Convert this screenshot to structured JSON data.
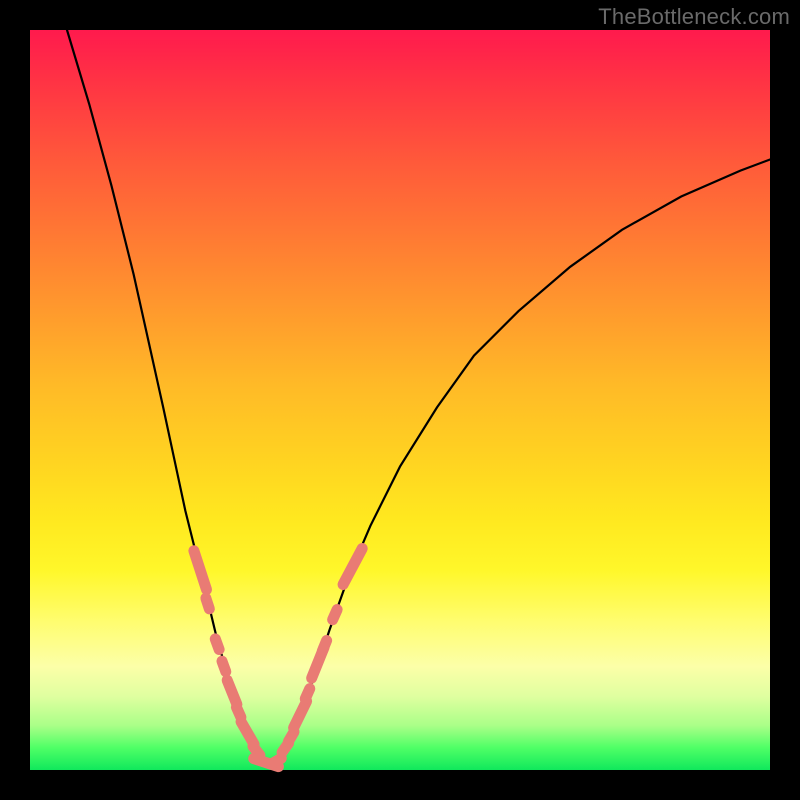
{
  "watermark": "TheBottleneck.com",
  "chart_data": {
    "type": "line",
    "title": "",
    "xlabel": "",
    "ylabel": "",
    "xlim": [
      0,
      100
    ],
    "ylim": [
      0,
      100
    ],
    "grid": false,
    "legend": false,
    "background": "vertical-gradient red→orange→yellow→green",
    "series": [
      {
        "name": "left-branch",
        "x": [
          5,
          8,
          11,
          14,
          16,
          18,
          19.5,
          21,
          22.5,
          24,
          25.2,
          26.5,
          27.7,
          29,
          30,
          31,
          31.8
        ],
        "y": [
          100,
          90,
          79,
          67,
          58,
          49,
          42,
          35,
          29,
          23,
          18,
          13.5,
          9.5,
          6,
          3.5,
          1.6,
          0.5
        ]
      },
      {
        "name": "right-branch",
        "x": [
          33,
          34,
          35.3,
          36.8,
          38.5,
          40.5,
          43,
          46,
          50,
          55,
          60,
          66,
          73,
          80,
          88,
          96,
          100
        ],
        "y": [
          0.5,
          1.8,
          4.2,
          8,
          13,
          19,
          26,
          33,
          41,
          49,
          56,
          62,
          68,
          73,
          77.5,
          81,
          82.5
        ]
      }
    ],
    "markers": {
      "description": "salmon pill-shaped markers on both branches roughly between y=5 and y=32",
      "points": [
        {
          "x": 23.0,
          "y": 27.0,
          "len": 7.0,
          "angle": -72
        },
        {
          "x": 24.0,
          "y": 22.5,
          "len": 3.0,
          "angle": -72
        },
        {
          "x": 25.3,
          "y": 17.0,
          "len": 3.0,
          "angle": -70
        },
        {
          "x": 26.2,
          "y": 14.0,
          "len": 3.0,
          "angle": -70
        },
        {
          "x": 27.3,
          "y": 10.5,
          "len": 5.0,
          "angle": -68
        },
        {
          "x": 28.2,
          "y": 7.8,
          "len": 3.0,
          "angle": -66
        },
        {
          "x": 29.4,
          "y": 5.0,
          "len": 5.0,
          "angle": -60
        },
        {
          "x": 30.6,
          "y": 2.6,
          "len": 3.0,
          "angle": -52
        },
        {
          "x": 31.9,
          "y": 1.0,
          "len": 5.0,
          "angle": -18
        },
        {
          "x": 33.3,
          "y": 1.2,
          "len": 3.0,
          "angle": 30
        },
        {
          "x": 34.5,
          "y": 3.0,
          "len": 3.0,
          "angle": 55
        },
        {
          "x": 35.3,
          "y": 4.5,
          "len": 3.0,
          "angle": 60
        },
        {
          "x": 36.5,
          "y": 7.5,
          "len": 5.5,
          "angle": 64
        },
        {
          "x": 37.5,
          "y": 10.3,
          "len": 3.0,
          "angle": 66
        },
        {
          "x": 38.9,
          "y": 14.5,
          "len": 6.0,
          "angle": 68
        },
        {
          "x": 39.8,
          "y": 16.8,
          "len": 3.0,
          "angle": 68
        },
        {
          "x": 41.2,
          "y": 21.0,
          "len": 3.0,
          "angle": 66
        },
        {
          "x": 43.6,
          "y": 27.5,
          "len": 7.0,
          "angle": 62
        }
      ]
    }
  },
  "colors": {
    "marker": "#e97b74",
    "curve": "#000000",
    "frame": "#000000",
    "watermark": "#6a6a6a"
  }
}
